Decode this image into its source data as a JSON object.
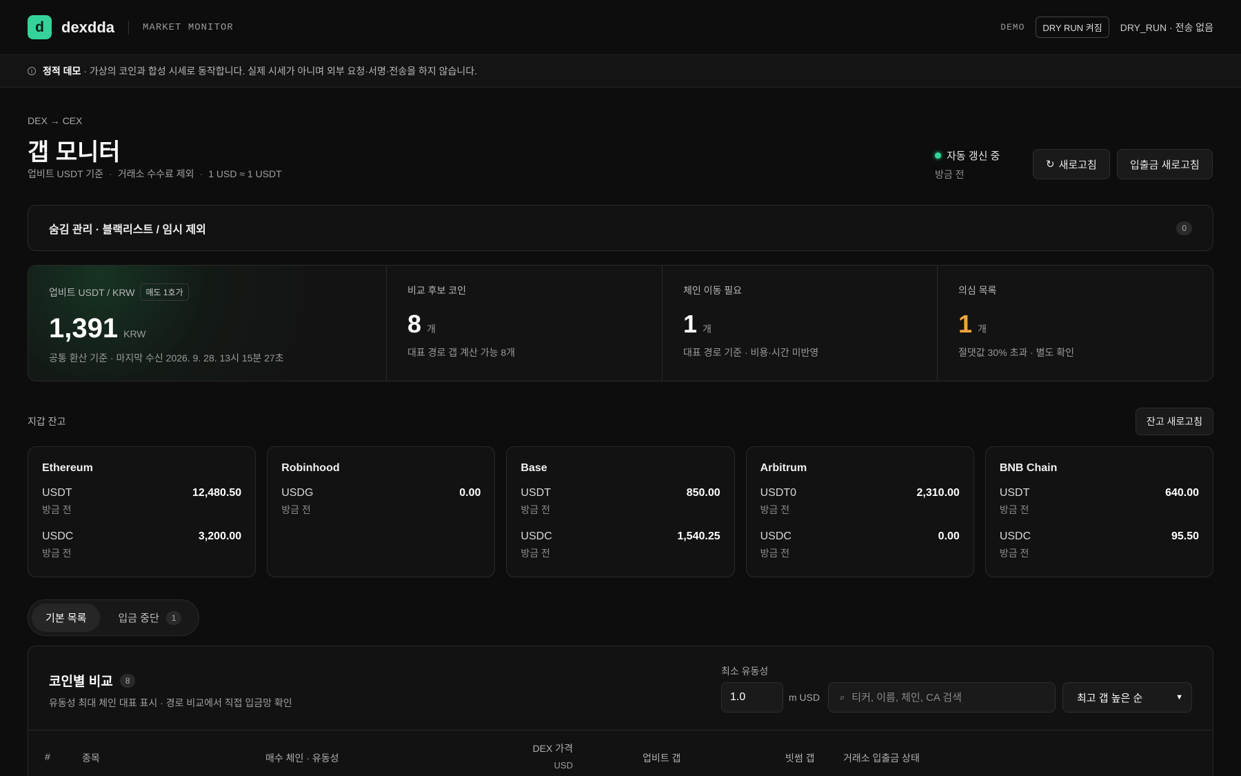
{
  "app": {
    "logo_letter": "d",
    "name": "dexdda",
    "subtitle": "MARKET MONITOR",
    "accent": "#35d39a"
  },
  "topbar": {
    "demo": "DEMO",
    "dry_run_badge": "DRY RUN 켜짐",
    "dry_run_status": "DRY_RUN · 전송 없음"
  },
  "notice": {
    "icon": "info-icon",
    "bold": "정적 데모",
    "text": " · 가상의 코인과 합성 시세로 동작합니다. 실제 시세가 아니며 외부 요청·서명·전송을 하지 않습니다."
  },
  "header": {
    "breadcrumb": "DEX → CEX",
    "title": "갭 모니터",
    "meta": [
      "업비트 USDT 기준",
      "거래소 수수료 제외",
      "1 USD ≈ 1 USDT"
    ],
    "status": "자동 갱신 중",
    "status_sub": "방금 전",
    "refresh_label": "새로고침",
    "io_refresh_label": "입출금 새로고침"
  },
  "hide_panel": {
    "title": "숨김 관리 · 블랙리스트 / 임시 제외",
    "count": "0"
  },
  "stats": [
    {
      "label": "업비트 USDT / KRW",
      "tag": "매도 1호가",
      "value": "1,391",
      "unit": "KRW",
      "note": "공통 환산 기준 · 마지막 수신 2026. 9. 28. 13시 15분 27초"
    },
    {
      "label": "비교 후보 코인",
      "value": "8",
      "unit": "개",
      "note": "대표 경로 갭 계산 가능 8개"
    },
    {
      "label": "체인 이동 필요",
      "value": "1",
      "unit": "개",
      "note": "대표 경로 기준 · 비용·시간 미반영"
    },
    {
      "label": "의심 목록",
      "value": "1",
      "unit": "개",
      "note": "절댓값 30% 초과 · 별도 확인",
      "color": "#f0a43a"
    }
  ],
  "wallet": {
    "title": "지갑 잔고",
    "refresh_label": "잔고 새로고침",
    "chains": [
      {
        "name": "Ethereum",
        "assets": [
          {
            "sym": "USDT",
            "amt": "12,480.50",
            "sub": "방금 전"
          },
          {
            "sym": "USDC",
            "amt": "3,200.00",
            "sub": "방금 전"
          }
        ]
      },
      {
        "name": "Robinhood",
        "assets": [
          {
            "sym": "USDG",
            "amt": "0.00",
            "sub": "방금 전"
          }
        ]
      },
      {
        "name": "Base",
        "assets": [
          {
            "sym": "USDT",
            "amt": "850.00",
            "sub": "방금 전"
          },
          {
            "sym": "USDC",
            "amt": "1,540.25",
            "sub": "방금 전"
          }
        ]
      },
      {
        "name": "Arbitrum",
        "assets": [
          {
            "sym": "USDT0",
            "amt": "2,310.00",
            "sub": "방금 전"
          },
          {
            "sym": "USDC",
            "amt": "0.00",
            "sub": "방금 전"
          }
        ]
      },
      {
        "name": "BNB Chain",
        "assets": [
          {
            "sym": "USDT",
            "amt": "640.00",
            "sub": "방금 전"
          },
          {
            "sym": "USDC",
            "amt": "95.50",
            "sub": "방금 전"
          }
        ]
      }
    ]
  },
  "tabs": [
    {
      "label": "기본 목록",
      "active": true
    },
    {
      "label": "입금 중단",
      "count": "1"
    }
  ],
  "compare": {
    "title": "코인별 비교",
    "count": "8",
    "sub": "유동성 최대 체인 대표 표시 · 경로 비교에서 직접 입금망 확인",
    "min_liq_label": "최소 유동성",
    "min_liq_value": "1.0",
    "min_liq_unit": "m USD",
    "search_placeholder": "티커, 이름, 체인, CA 검색",
    "sort_value": "최고 갭 높은 순",
    "columns": {
      "idx": "#",
      "name": "종목",
      "chain": "매수 체인 · 유동성",
      "price": "DEX 가격",
      "price_unit": "USD",
      "upbit": "업비트 갭",
      "bithumb": "빗썸 갭",
      "status": "거래소 입출금 상태"
    }
  }
}
